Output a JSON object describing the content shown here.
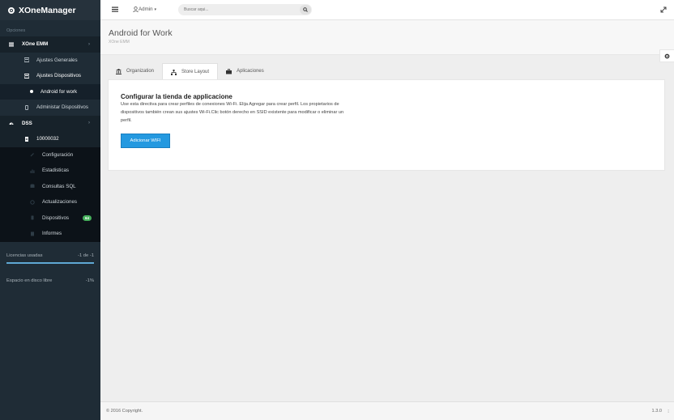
{
  "app": {
    "brand": "XOneManager"
  },
  "sidebar": {
    "section_label": "Opciones",
    "items": [
      {
        "label": "XOne EMM",
        "level": 1,
        "icon": "list-icon"
      },
      {
        "label": "Ajustes Generales",
        "level": 2,
        "icon": "card-icon"
      },
      {
        "label": "Ajustes Dispositivos",
        "level": 2,
        "icon": "card-icon",
        "active": true
      },
      {
        "label": "Android for work",
        "level": 3
      },
      {
        "label": "Administar Dispositivos",
        "level": 2,
        "icon": "device-icon"
      },
      {
        "label": "DSS",
        "level": 1,
        "icon": "dashboard-icon"
      },
      {
        "label": "10000032",
        "level": 2,
        "icon": "file-icon"
      },
      {
        "label": "Configuración",
        "level": 3
      },
      {
        "label": "Estadisticas",
        "level": 3
      },
      {
        "label": "Consultas SQL",
        "level": 3
      },
      {
        "label": "Actualizaciones",
        "level": 3
      },
      {
        "label": "Dispositivos",
        "level": 3,
        "badge": "64"
      },
      {
        "label": "Informes",
        "level": 3
      }
    ],
    "stats": [
      {
        "label": "Licencias usadas",
        "value": "-1 de -1"
      },
      {
        "label": "Espacio en disco libre",
        "value": "-1%"
      }
    ]
  },
  "topbar": {
    "user_label": "Admin",
    "search_placeholder": "Buscar aqui..."
  },
  "page": {
    "title": "Android for Work",
    "subtitle": "XOne EMM"
  },
  "tabs": [
    {
      "label": "Organization",
      "icon": "bank-icon"
    },
    {
      "label": "Store Layout",
      "icon": "sitemap-icon",
      "active": true
    },
    {
      "label": "Aplicaciones",
      "icon": "briefcase-icon"
    }
  ],
  "panel": {
    "title": "Configurar la tienda de applicacione",
    "description": "Use esta directiva para crear perfiles de conexiones Wi-Fi. Elija Agregar para crear perfil. Los propietarios de dispositivos también crean sus ajustes Wi-Fi.Clic botón derecho en SSID existente para modificar o eliminar un perfil.",
    "button_label": "Adicionar WIFI"
  },
  "footer": {
    "copyright": "© 2016 Copyright.",
    "version": "1.3.0"
  },
  "colors": {
    "sidebar_bg": "#1f2c36",
    "accent": "#2499e0",
    "badge": "#46b05c"
  }
}
